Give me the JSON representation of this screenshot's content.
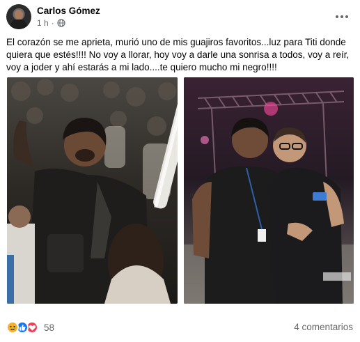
{
  "post": {
    "author": "Carlos Gómez",
    "time": "1 h",
    "separator": "·",
    "privacy_icon": "globe-icon",
    "more_icon": "more-horizontal-icon",
    "text": "El corazón se me aprieta, murió uno de mis guajiros favoritos...luz para Titi donde quiera que estés!!!! No voy a llorar, hoy voy a darle una sonrisa a todos, voy a reír, voy a joder y ahí estarás a mi lado....te quiero mucho mi negro!!!!",
    "photos": [
      {
        "icon": "photo-concert-crowd"
      },
      {
        "icon": "photo-two-men-stage"
      }
    ],
    "reactions": {
      "icons": [
        "sad-reaction-icon",
        "like-reaction-icon",
        "love-reaction-icon"
      ],
      "count": "58"
    },
    "comments_label": "4 comentarios"
  },
  "colors": {
    "like": "#1877f2",
    "love": "#f33e58",
    "sad": "#f7b125",
    "secondary_text": "#65676b"
  }
}
